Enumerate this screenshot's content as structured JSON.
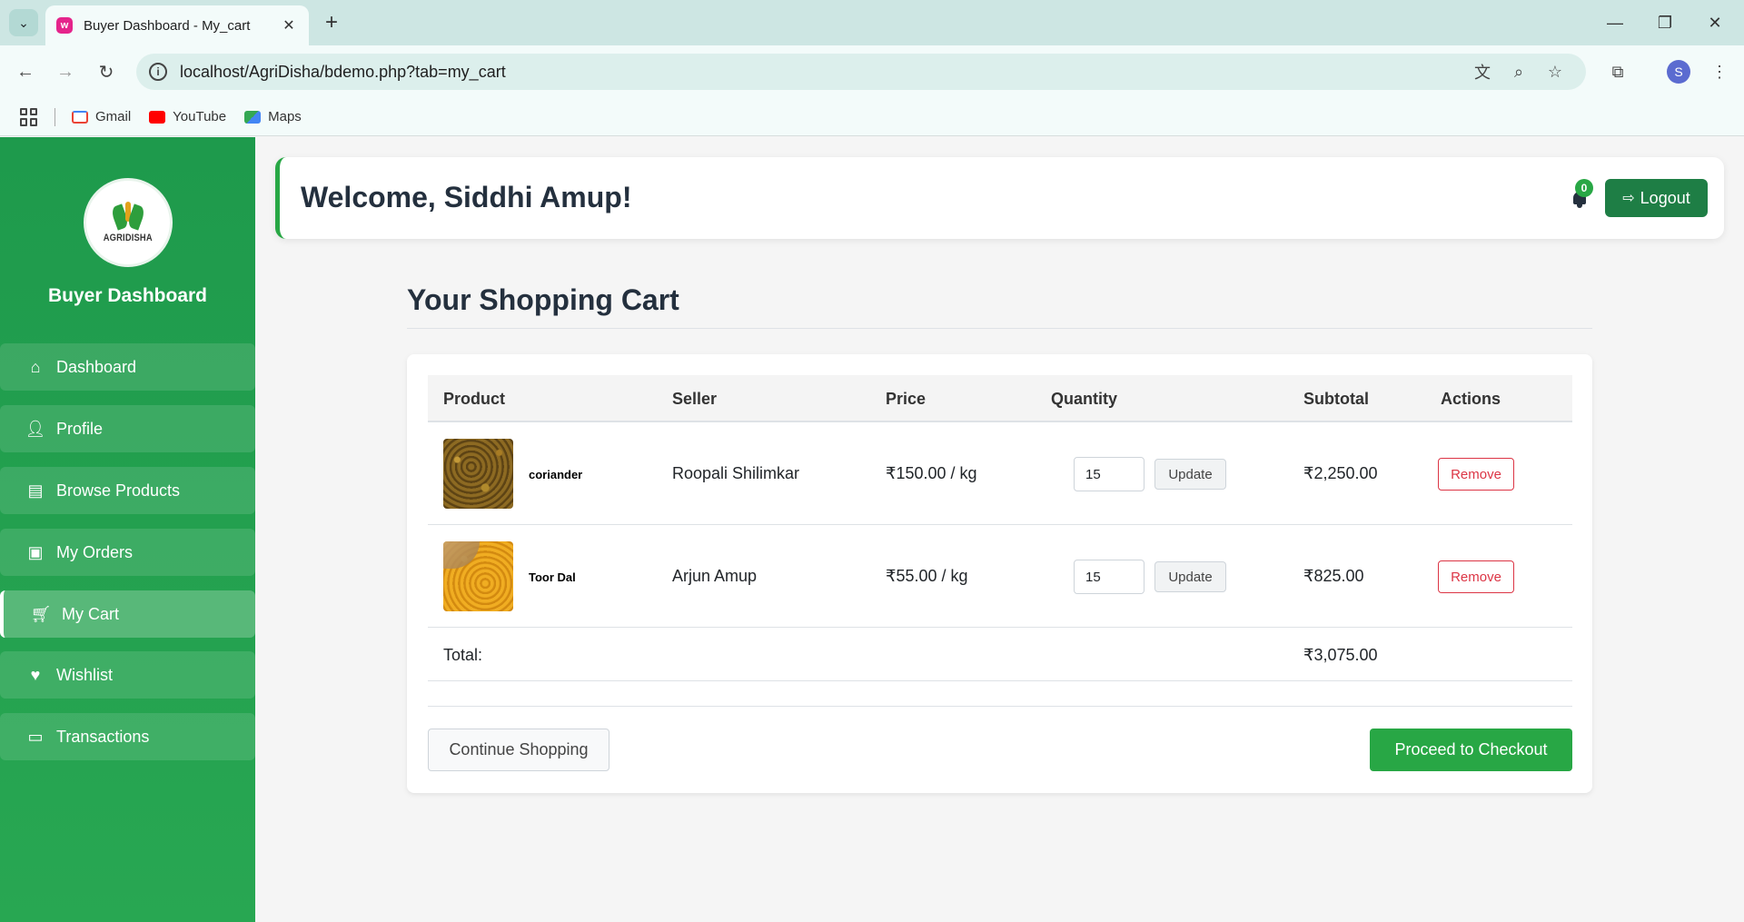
{
  "browser": {
    "tab_title": "Buyer Dashboard - My_cart",
    "url": "localhost/AgriDisha/bdemo.php?tab=my_cart",
    "profile_initial": "S",
    "bookmarks": [
      {
        "label": "Gmail",
        "icon": "gmail-icon",
        "color": "#ea4335"
      },
      {
        "label": "YouTube",
        "icon": "youtube-icon",
        "color": "#ff0000"
      },
      {
        "label": "Maps",
        "icon": "maps-icon",
        "color": "#34a853"
      }
    ]
  },
  "sidebar": {
    "logo_text": "AGRIDISHA",
    "title": "Buyer Dashboard",
    "items": [
      {
        "label": "Dashboard",
        "icon": "home-icon"
      },
      {
        "label": "Profile",
        "icon": "user-icon"
      },
      {
        "label": "Browse Products",
        "icon": "store-icon"
      },
      {
        "label": "My Orders",
        "icon": "box-icon"
      },
      {
        "label": "My Cart",
        "icon": "cart-icon",
        "active": true
      },
      {
        "label": "Wishlist",
        "icon": "heart-icon"
      },
      {
        "label": "Transactions",
        "icon": "credit-card-icon"
      }
    ]
  },
  "header": {
    "welcome": "Welcome, Siddhi Amup!",
    "notification_count": "0",
    "logout_label": "Logout"
  },
  "cart": {
    "title": "Your Shopping Cart",
    "columns": [
      "Product",
      "Seller",
      "Price",
      "Quantity",
      "Subtotal",
      "Actions"
    ],
    "items": [
      {
        "product": "coriander",
        "seller": "Roopali Shilimkar",
        "price": "₹150.00 / kg",
        "quantity": "15",
        "subtotal": "₹2,250.00",
        "update_label": "Update",
        "remove_label": "Remove"
      },
      {
        "product": "Toor Dal",
        "seller": "Arjun Amup",
        "price": "₹55.00 / kg",
        "quantity": "15",
        "subtotal": "₹825.00",
        "update_label": "Update",
        "remove_label": "Remove"
      }
    ],
    "total_label": "Total:",
    "total_value": "₹3,075.00",
    "continue_label": "Continue Shopping",
    "checkout_label": "Proceed to Checkout"
  },
  "colors": {
    "brand_green": "#28a745",
    "sidebar_green": "#1e9a4c",
    "logout_green": "#1e7e45",
    "remove_red": "#dc3545"
  }
}
